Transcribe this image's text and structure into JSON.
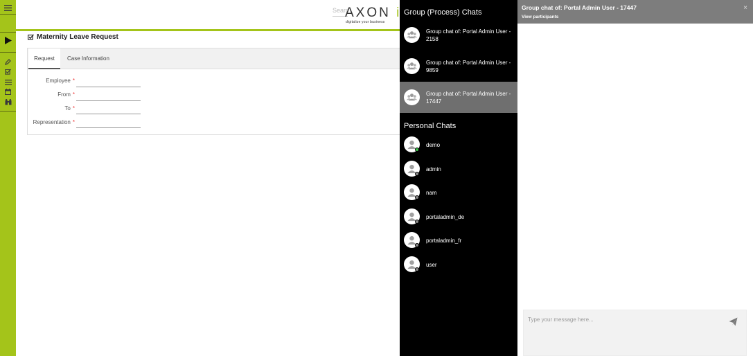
{
  "sidebar": {
    "menu_icon": "hamburger-icon",
    "play_icon": "play-icon",
    "nav_icons": [
      "pencil-icon",
      "checkbox-icon",
      "list-icon",
      "calendar-icon",
      "binoculars-icon"
    ],
    "color": "#a4c41a"
  },
  "header": {
    "search_placeholder": "Search",
    "logo_text": "AXON",
    "logo_suffix": "iV",
    "tagline": "digitalize your business"
  },
  "form": {
    "title": "Maternity Leave Request",
    "tabs": [
      {
        "label": "Request",
        "active": true
      },
      {
        "label": "Case Information",
        "active": false
      }
    ],
    "fields": [
      {
        "label": "Employee",
        "required": "*"
      },
      {
        "label": "From",
        "required": "*"
      },
      {
        "label": "To",
        "required": "*"
      },
      {
        "label": "Representation",
        "required": "*"
      }
    ]
  },
  "chat_list": {
    "group_section_title": "Group (Process) Chats",
    "groups": [
      {
        "name": "Group chat of: Portal Admin User - 2158",
        "active": false
      },
      {
        "name": "Group chat of: Portal Admin User - 9859",
        "active": false
      },
      {
        "name": "Group chat of: Portal Admin User - 17447",
        "active": true
      }
    ],
    "personal_section_title": "Personal Chats",
    "personal": [
      {
        "name": "demo",
        "status": "online"
      },
      {
        "name": "admin",
        "status": "offline"
      },
      {
        "name": "nam",
        "status": "offline"
      },
      {
        "name": "portaladmin_de",
        "status": "offline"
      },
      {
        "name": "portaladmin_fr",
        "status": "offline"
      },
      {
        "name": "user",
        "status": "offline"
      }
    ]
  },
  "conversation": {
    "title": "Group chat of: Portal Admin User - 17447",
    "participants_link": "View participants",
    "close_label": "×",
    "message_placeholder": "Type your message here...",
    "header_color": "#7d7d7d"
  },
  "colors": {
    "accent": "#a4c41a",
    "online": "#3cc24a",
    "offline": "#888888"
  }
}
